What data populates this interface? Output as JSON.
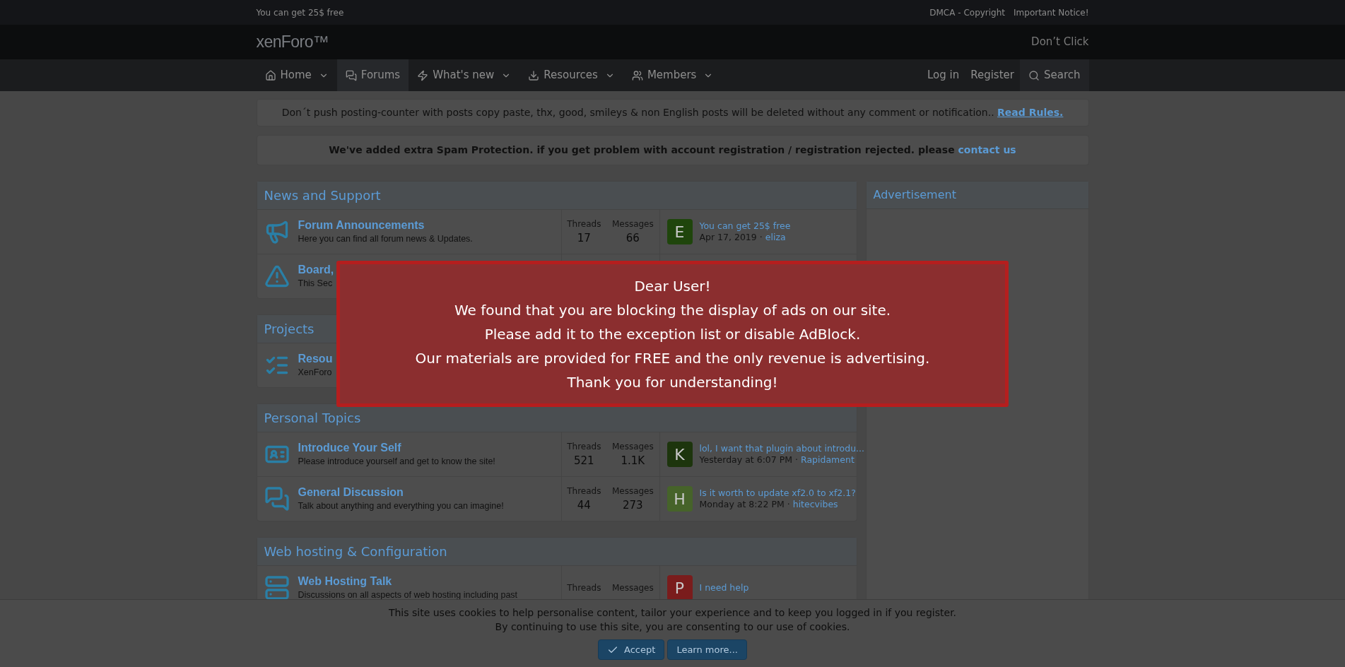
{
  "top_bar": {
    "left": "You can get 25$ free",
    "links": [
      "DMCA - Copyright",
      "Important Notice!"
    ]
  },
  "header": {
    "logo": "xenForo™",
    "right_link": "Don’t Click"
  },
  "nav": {
    "items": [
      {
        "kind": "home",
        "label": "Home",
        "has_menu": true,
        "selected": false
      },
      {
        "kind": "forums",
        "label": "Forums",
        "has_menu": false,
        "selected": true
      },
      {
        "kind": "new",
        "label": "What's new",
        "has_menu": true,
        "selected": false
      },
      {
        "kind": "resources",
        "label": "Resources",
        "has_menu": true,
        "selected": false
      },
      {
        "kind": "members",
        "label": "Members",
        "has_menu": true,
        "selected": false
      }
    ],
    "right": [
      {
        "kind": "link",
        "label": "Log in"
      },
      {
        "kind": "link",
        "label": "Register"
      },
      {
        "kind": "search",
        "label": "Search"
      }
    ]
  },
  "notices": [
    {
      "kind": "plain",
      "text": "Don´t push posting-counter with posts copy paste, thx, good, smileys & non English posts will be deleted without any comment or notification..",
      "link": "Read Rules."
    },
    {
      "kind": "bold",
      "text": "We've added extra Spam Protection. if you get problem with account registration / registration rejected. please",
      "link": "contact us"
    }
  ],
  "categories": [
    {
      "title": "News and Support",
      "forums": [
        {
          "kind": "announcements",
          "title": "Forum Announcements",
          "description": "Here you can find all forum news & Updates.",
          "threads_label": "Threads",
          "threads": "17",
          "messages_label": "Messages",
          "messages": "66",
          "latest": {
            "avatar": {
              "kind": "letter",
              "letter": "E",
              "color": "#1f450c"
            },
            "title": "You can get 25$ free",
            "date": "Apr 17, 2019",
            "separator": "·",
            "user": "eliza"
          }
        },
        {
          "kind": "problems",
          "title": "Board,",
          "description": "This Sec"
        }
      ]
    },
    {
      "title": "Projects",
      "forums": [
        {
          "kind": "projects",
          "title": "Resou",
          "description": "XenForo"
        }
      ]
    },
    {
      "title": "Personal Topics",
      "forums": [
        {
          "kind": "introduce",
          "title": "Introduce Your Self",
          "description": "Please introduce yourself and get to know the site!",
          "threads_label": "Threads",
          "threads": "521",
          "messages_label": "Messages",
          "messages": "1.1K",
          "latest": {
            "avatar": {
              "kind": "letter",
              "letter": "K",
              "color": "#1d350d"
            },
            "title": "lol, I want that plugin about introdu...",
            "date": "Yesterday at 6:07 PM",
            "separator": "·",
            "user": "Rapidament"
          }
        },
        {
          "kind": "discussion",
          "title": "General Discussion",
          "description": "Talk about anything and everything you can imagine!",
          "threads_label": "Threads",
          "threads": "44",
          "messages_label": "Messages",
          "messages": "273",
          "latest": {
            "avatar": {
              "kind": "letter",
              "letter": "H",
              "color": "#46632a"
            },
            "title": "Is it worth to update xf2.0 to xf2.1?",
            "date": "Monday at 8:22 PM",
            "separator": "·",
            "user": "hitecvibes"
          }
        }
      ]
    },
    {
      "title": "Web hosting & Configuration",
      "forums": [
        {
          "kind": "hosting",
          "title": "Web Hosting Talk",
          "description": "Discussions on all aspects of web hosting including past",
          "threads_label": "Threads",
          "messages_label": "Messages",
          "latest": {
            "avatar": {
              "kind": "letter",
              "letter": "P",
              "color": "#7a1c1c"
            },
            "title": "I need help"
          }
        }
      ]
    }
  ],
  "sidebar": {
    "title": "Advertisement"
  },
  "modal": {
    "lines": [
      "Dear User!",
      "We found that you are blocking the display of ads on our site.",
      "Please add it to the exception list or disable AdBlock.",
      "Our materials are provided for FREE and the only revenue is advertising.",
      "Thank you for understanding!"
    ]
  },
  "cookie_bar": {
    "lines": [
      "This site uses cookies to help personalise content, tailor your experience and to keep you logged in if you register.",
      "By continuing to use this site, you are consenting to our use of cookies."
    ],
    "buttons": [
      {
        "label": "Accept",
        "kind": "primary"
      },
      {
        "label": "Learn more...",
        "kind": "secondary"
      }
    ]
  }
}
